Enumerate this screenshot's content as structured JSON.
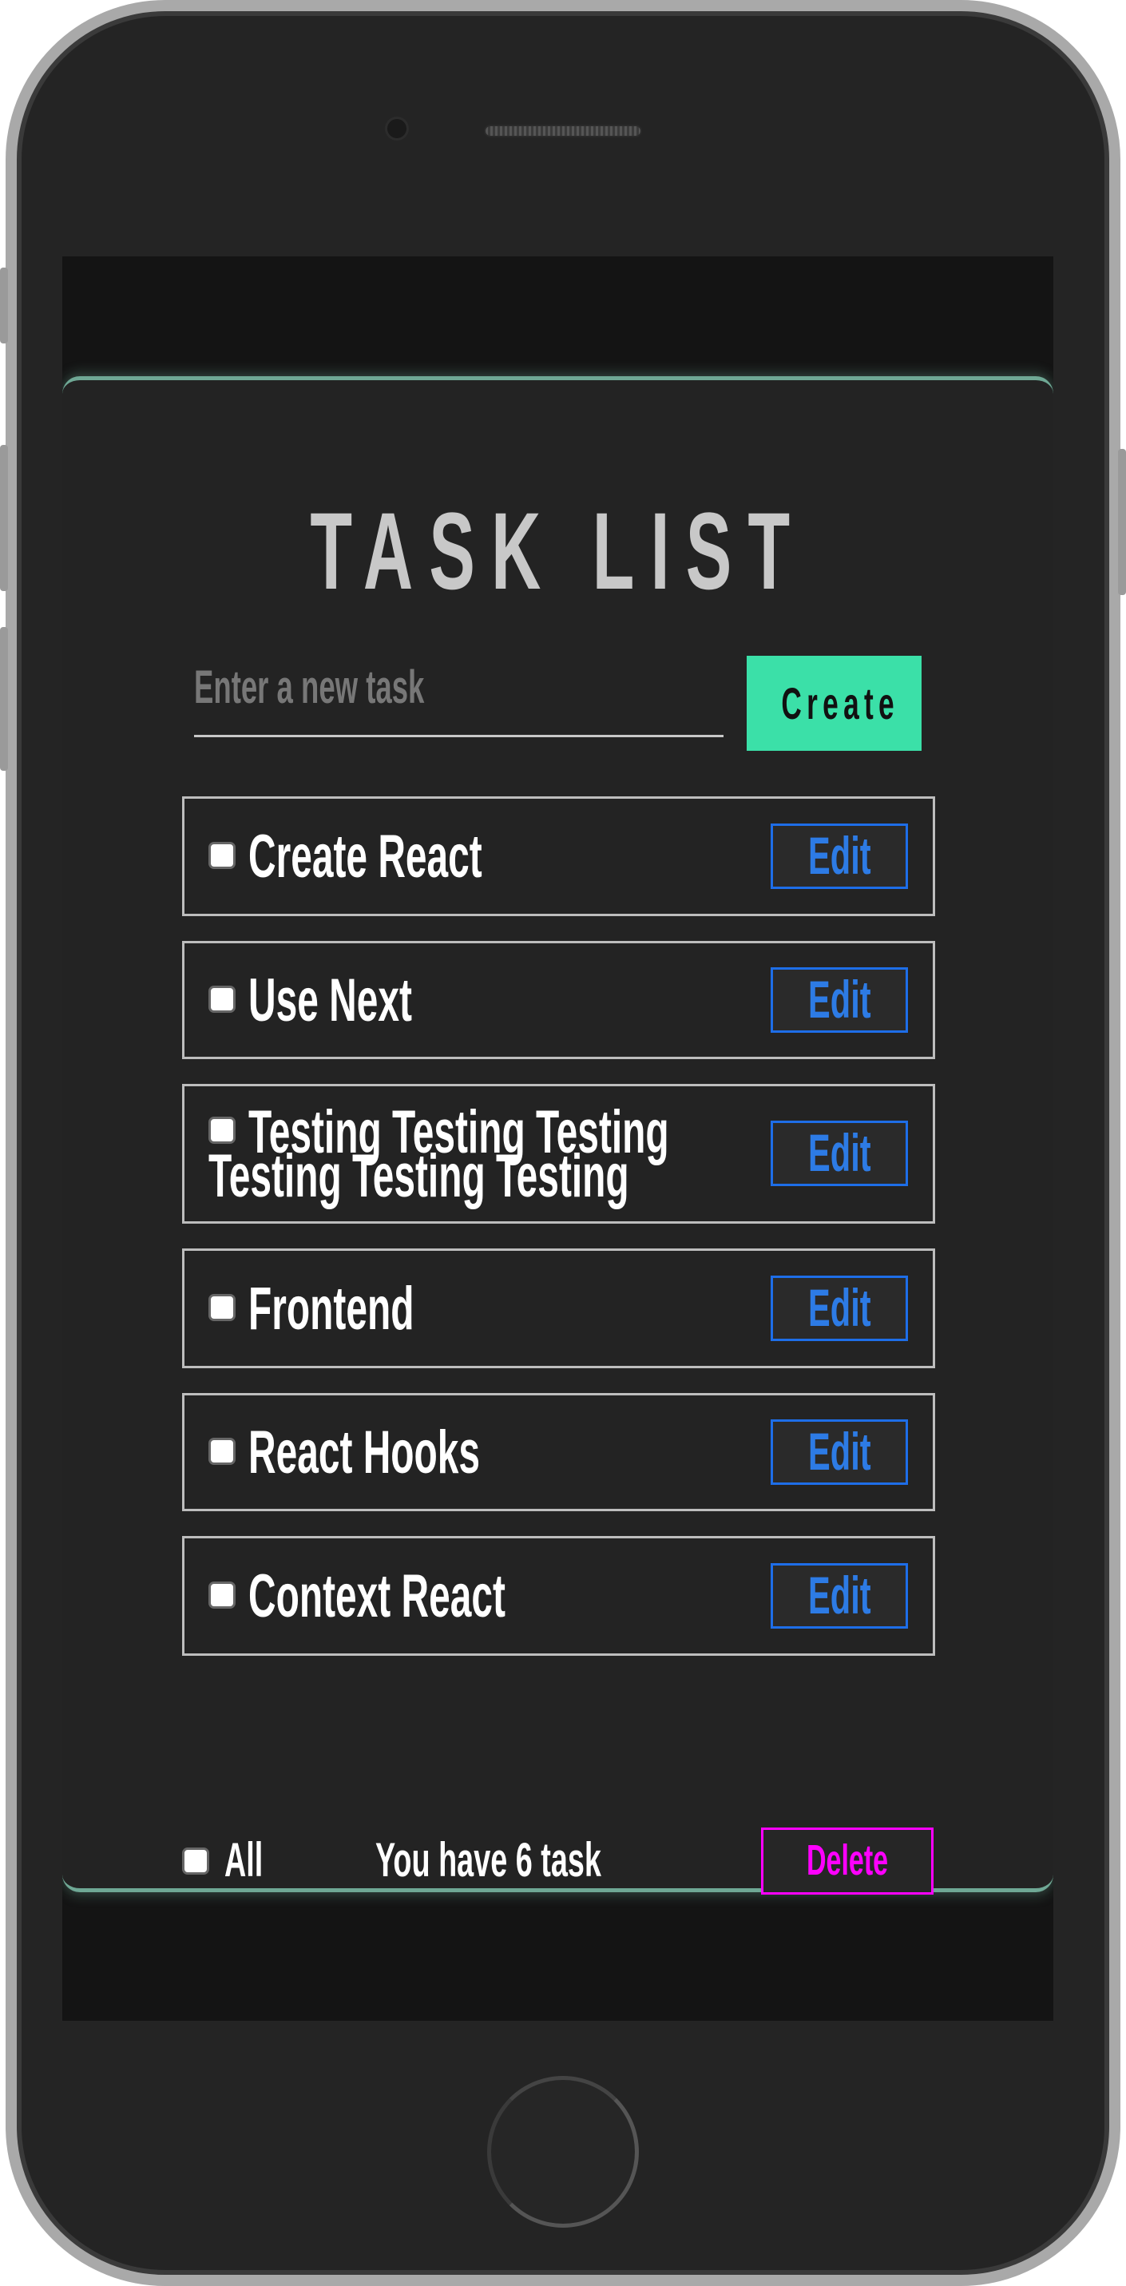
{
  "app": {
    "title": "TASK LIST",
    "input": {
      "placeholder": "Enter a new task",
      "value": ""
    },
    "create_label": "Create",
    "tasks": [
      {
        "text": "Create React",
        "checked": false,
        "edit_label": "Edit"
      },
      {
        "text": "Use Next",
        "checked": false,
        "edit_label": "Edit"
      },
      {
        "text_line1": "Testing Testing Testing",
        "text_line2": "Testing Testing Testing",
        "checked": false,
        "edit_label": "Edit"
      },
      {
        "text": "Frontend",
        "checked": false,
        "edit_label": "Edit"
      },
      {
        "text": "React Hooks",
        "checked": false,
        "edit_label": "Edit"
      },
      {
        "text": "Context React",
        "checked": false,
        "edit_label": "Edit"
      }
    ],
    "footer": {
      "all_label": "All",
      "count_text": "You have 6 task",
      "delete_label": "Delete"
    }
  },
  "colors": {
    "accent": "#3be0a8",
    "edit": "#2d7be5",
    "delete": "#ff00ff",
    "card": "#232323"
  }
}
